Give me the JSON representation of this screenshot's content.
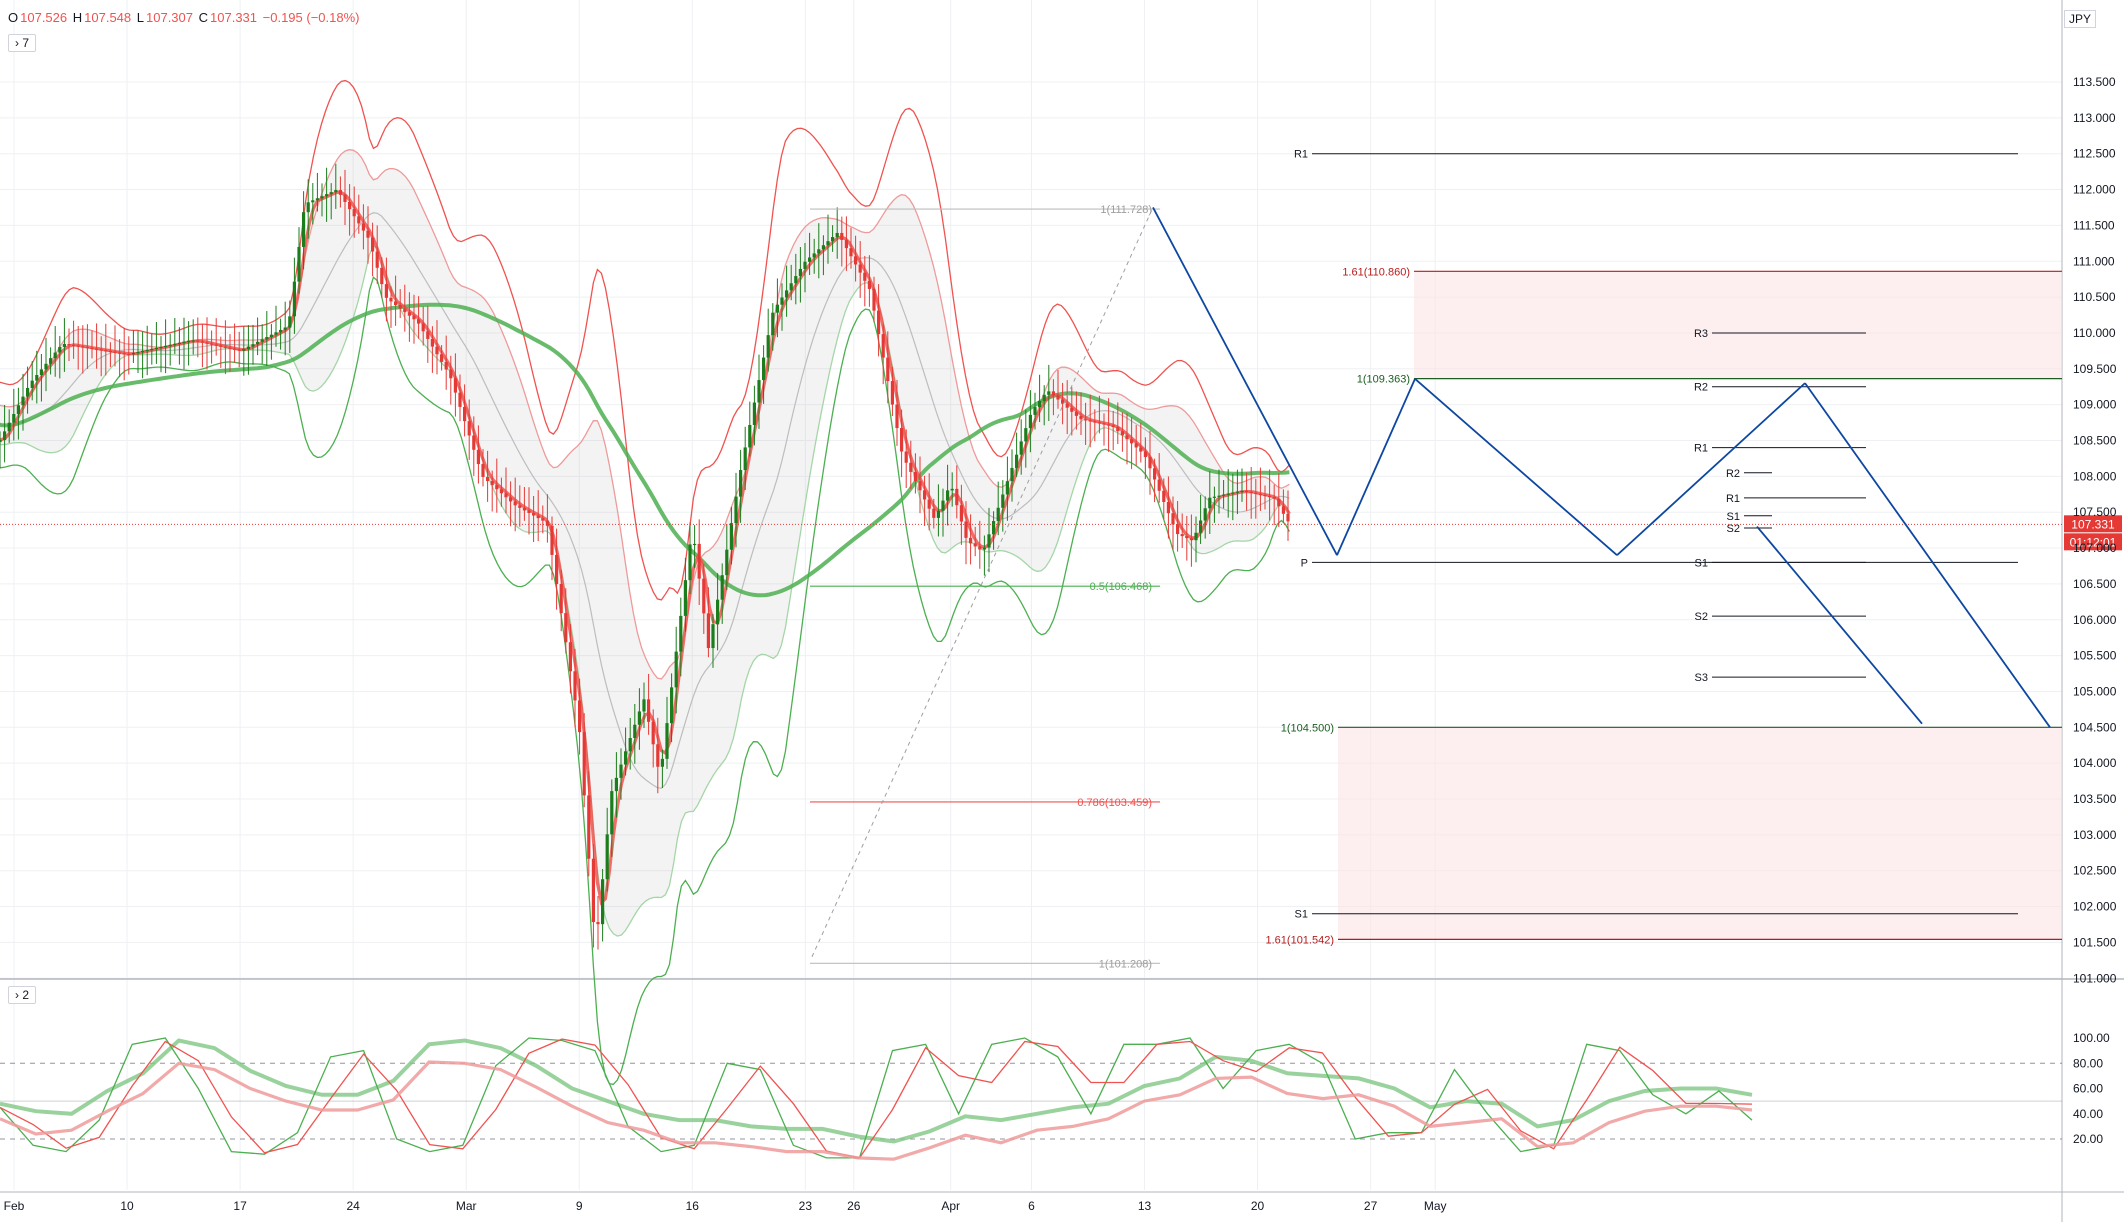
{
  "header": {
    "open_label": "O",
    "open": "107.526",
    "high_label": "H",
    "high": "107.548",
    "low_label": "L",
    "low": "107.307",
    "close_label": "C",
    "close": "107.331",
    "change": "−0.195 (−0.18%)",
    "main_legend_toggle": "› 7",
    "osc_legend_toggle": "› 2",
    "currency": "JPY"
  },
  "price_tag": {
    "value": "107.331",
    "countdown": "01:12:01"
  },
  "colors": {
    "bull": "#1b7d1b",
    "bear": "#e53935",
    "red_line": "#ef5350",
    "green_line": "#4caf50",
    "navy": "#0d47a1",
    "grid": "#eef0f3",
    "dark_red": "#b71c1c"
  },
  "chart_data": [
    {
      "type": "candlestick",
      "symbol_currency": "JPY",
      "ylim": [
        100.5,
        114.0
      ],
      "y_ticks": [
        "101.000",
        "101.500",
        "102.000",
        "102.500",
        "103.000",
        "103.500",
        "104.000",
        "104.500",
        "105.000",
        "105.500",
        "106.000",
        "106.500",
        "107.000",
        "107.500",
        "108.000",
        "108.500",
        "109.000",
        "109.500",
        "110.000",
        "110.500",
        "111.000",
        "111.500",
        "112.000",
        "112.500",
        "113.000",
        "113.500"
      ],
      "x_ticks": [
        "Feb",
        "10",
        "17",
        "24",
        "Mar",
        "9",
        "16",
        "23",
        "26",
        "Apr",
        "6",
        "13",
        "20",
        "27",
        "May"
      ],
      "price_path": [
        [
          "Jan 30",
          109.0
        ],
        [
          "Feb 2",
          108.45
        ],
        [
          "Feb 4",
          109.3
        ],
        [
          "Feb 6",
          109.85
        ],
        [
          "Feb 10",
          109.7
        ],
        [
          "Feb 14",
          109.9
        ],
        [
          "Feb 17",
          109.75
        ],
        [
          "Feb 20",
          110.1
        ],
        [
          "Feb 21",
          111.8
        ],
        [
          "Feb 23",
          112.0
        ],
        [
          "Feb 25",
          111.3
        ],
        [
          "Feb 26",
          110.5
        ],
        [
          "Feb 28",
          110.15
        ],
        [
          "Mar 1",
          109.4
        ],
        [
          "Mar 3",
          108.0
        ],
        [
          "Mar 5",
          107.6
        ],
        [
          "Mar 7",
          107.35
        ],
        [
          "Mar 9",
          104.5
        ],
        [
          "Mar 10",
          101.4
        ],
        [
          "Mar 11",
          103.6
        ],
        [
          "Mar 13",
          104.9
        ],
        [
          "Mar 14",
          103.8
        ],
        [
          "Mar 16",
          107.3
        ],
        [
          "Mar 17",
          105.6
        ],
        [
          "Mar 18",
          106.8
        ],
        [
          "Mar 19",
          108.1
        ],
        [
          "Mar 21",
          110.3
        ],
        [
          "Mar 23",
          111.0
        ],
        [
          "Mar 25",
          111.4
        ],
        [
          "Mar 27",
          110.6
        ],
        [
          "Mar 29",
          108.3
        ],
        [
          "Mar 31",
          107.4
        ],
        [
          "Apr 1",
          107.9
        ],
        [
          "Apr 2",
          107.1
        ],
        [
          "Apr 3",
          106.95
        ],
        [
          "Apr 6",
          108.9
        ],
        [
          "Apr 7",
          109.2
        ],
        [
          "Apr 9",
          108.8
        ],
        [
          "Apr 11",
          108.7
        ],
        [
          "Apr 13",
          108.3
        ],
        [
          "Apr 15",
          107.2
        ],
        [
          "Apr 16",
          107.1
        ],
        [
          "Apr 17",
          107.7
        ],
        [
          "Apr 19",
          107.8
        ],
        [
          "Apr 21",
          107.7
        ],
        [
          "Apr 22",
          107.33
        ]
      ],
      "pivots": [
        {
          "label": "R1",
          "value": 112.5
        },
        {
          "label": "P",
          "value": 106.8
        },
        {
          "label": "S1",
          "value": 101.9
        },
        {
          "label": "R3",
          "value": 110.0
        },
        {
          "label": "R2",
          "value": 109.25
        },
        {
          "label": "R1",
          "value": 108.4
        },
        {
          "label": "S1",
          "value": 106.8
        },
        {
          "label": "S2",
          "value": 106.05
        },
        {
          "label": "S3",
          "value": 105.2
        },
        {
          "label": "R2",
          "value": 108.05
        },
        {
          "label": "R1",
          "value": 107.7
        },
        {
          "label": "S1",
          "value": 107.45
        },
        {
          "label": "S2",
          "value": 107.28
        }
      ],
      "fib_labels": [
        {
          "text": "1(111.728)",
          "value": 111.728
        },
        {
          "text": "0.5(106.468)",
          "value": 106.468
        },
        {
          "text": "0.786(103.459)",
          "value": 103.459
        },
        {
          "text": "1(101.208)",
          "value": 101.208
        },
        {
          "text": "1.61(110.860)",
          "value": 110.86
        },
        {
          "text": "1(109.363)",
          "value": 109.363
        },
        {
          "text": "1(104.500)",
          "value": 104.5
        },
        {
          "text": "1.61(101.542)",
          "value": 101.542
        }
      ],
      "current_price": 107.331
    },
    {
      "type": "line",
      "name_label": "2",
      "ylim": [
        0,
        110
      ],
      "y_ticks": [
        "100.00",
        "80.00",
        "60.00",
        "40.00",
        "20.00"
      ],
      "levels": [
        80,
        50,
        20
      ],
      "series": [
        {
          "values": [
            48,
            42,
            40,
            58,
            72,
            98,
            92,
            74,
            62,
            55,
            55,
            66,
            95,
            98,
            92,
            78,
            60,
            50,
            40,
            35,
            35,
            30,
            28,
            28,
            22,
            18,
            26,
            38,
            35,
            40,
            45,
            48,
            62,
            68,
            85,
            82,
            72,
            70,
            68,
            60,
            45,
            50,
            48,
            30,
            35,
            50,
            58,
            60,
            60,
            55
          ]
        },
        {
          "values": [
            45,
            15,
            10,
            35,
            95,
            100,
            60,
            10,
            8,
            25,
            85,
            90,
            20,
            10,
            15,
            78,
            100,
            98,
            90,
            30,
            10,
            15,
            80,
            75,
            15,
            5,
            5,
            90,
            95,
            40,
            95,
            100,
            85,
            40,
            95,
            95,
            100,
            60,
            90,
            95,
            80,
            20,
            25,
            25,
            75,
            40,
            10,
            15,
            95,
            90,
            55,
            40,
            58,
            35
          ]
        }
      ]
    }
  ]
}
